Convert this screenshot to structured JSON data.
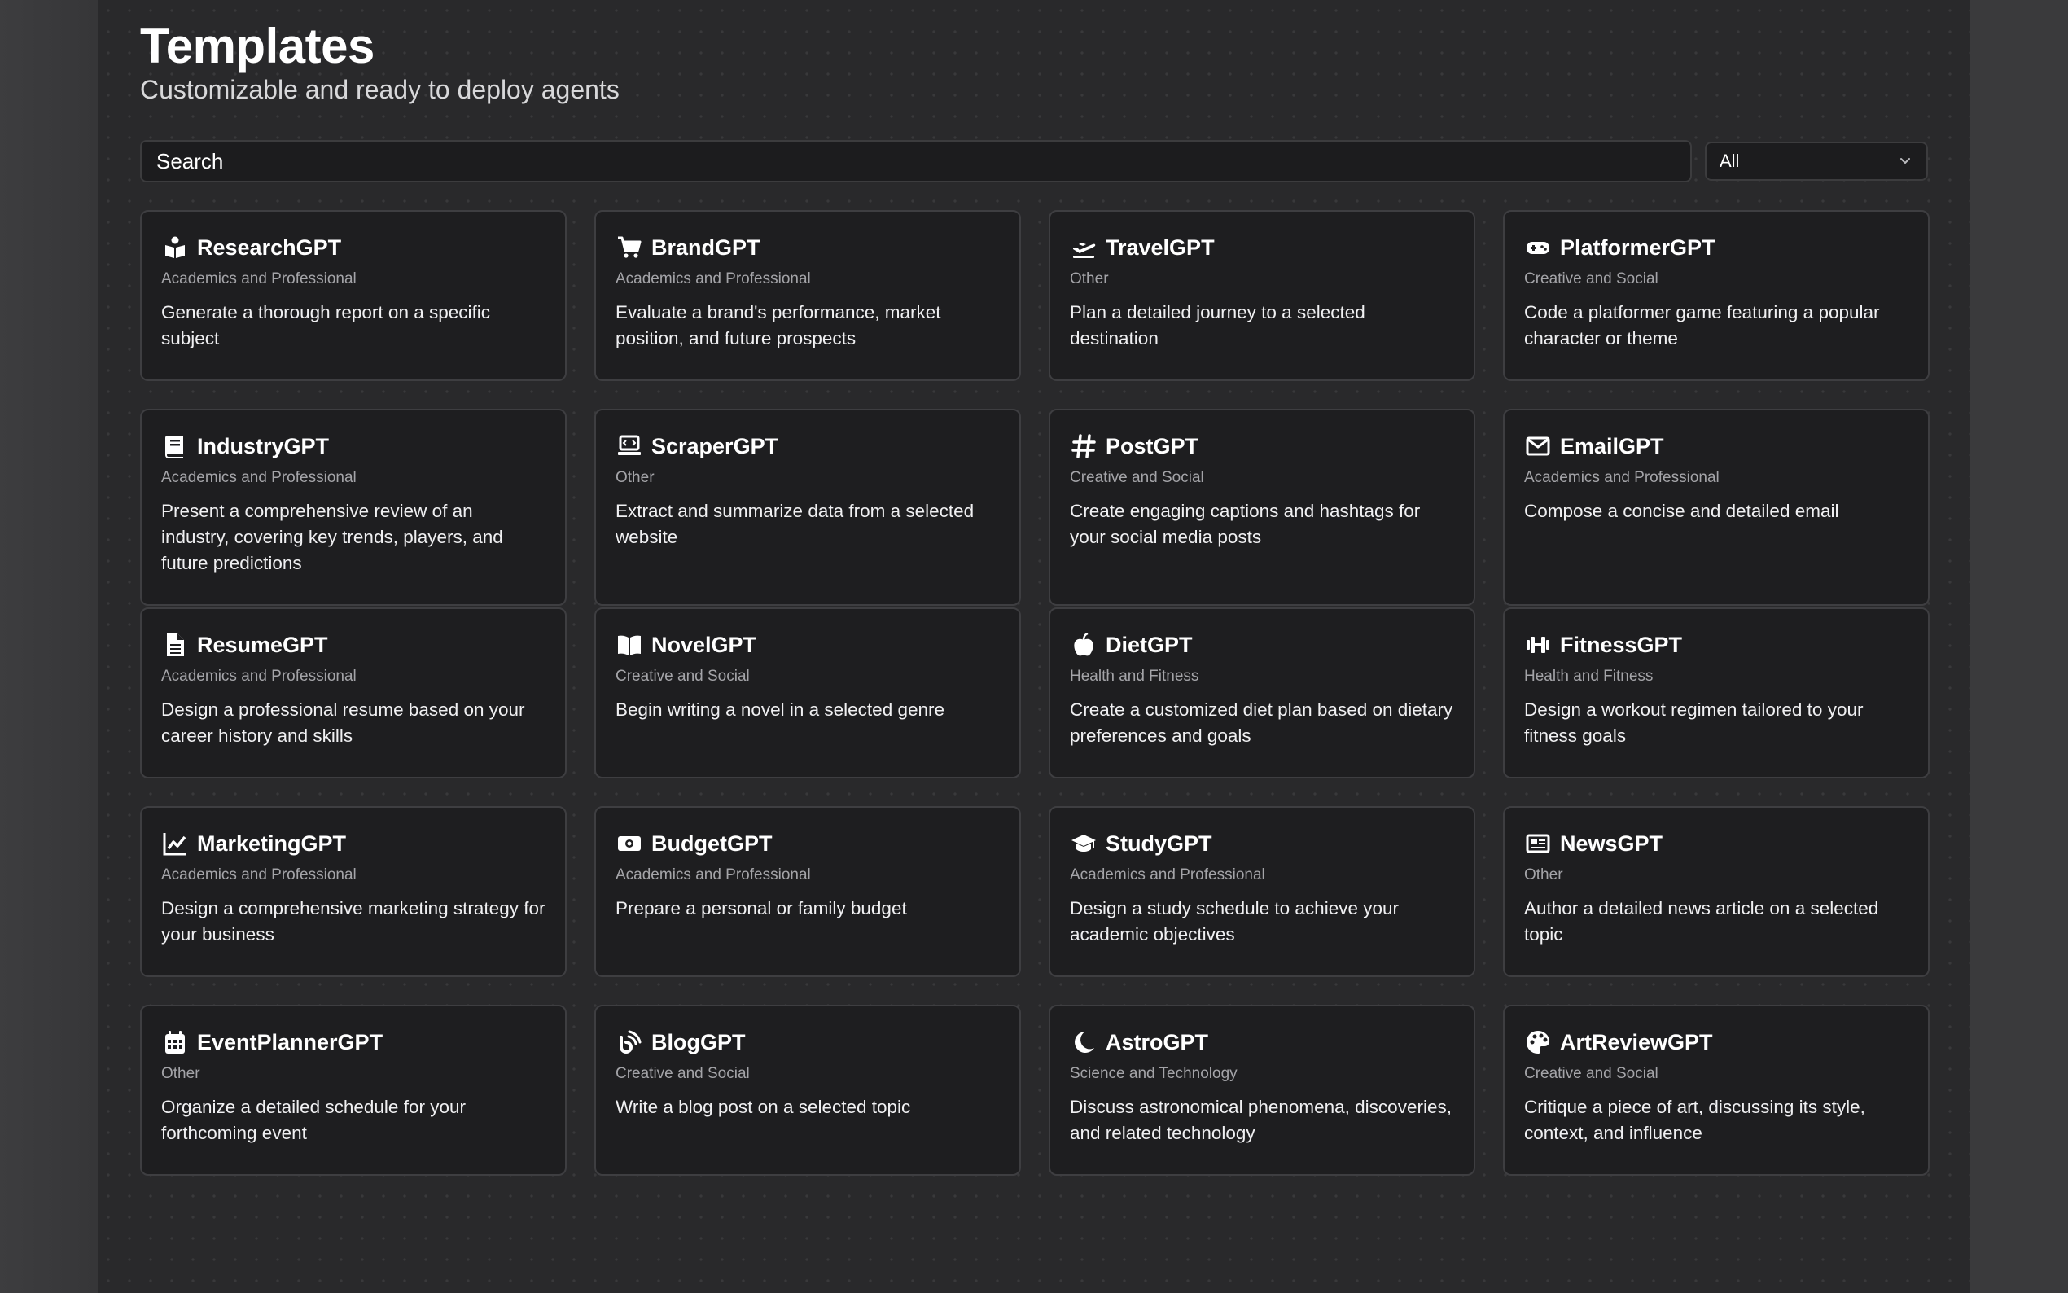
{
  "header": {
    "title": "Templates",
    "subtitle": "Customizable and ready to deploy agents"
  },
  "search": {
    "placeholder": "Search"
  },
  "filter": {
    "selected": "All"
  },
  "templates": [
    {
      "name": "ResearchGPT",
      "category": "Academics and Professional",
      "description": "Generate a thorough report on a specific subject",
      "icon": "user-book-icon"
    },
    {
      "name": "BrandGPT",
      "category": "Academics and Professional",
      "description": "Evaluate a brand's performance, market position, and future prospects",
      "icon": "cart-icon"
    },
    {
      "name": "TravelGPT",
      "category": "Other",
      "description": "Plan a detailed journey to a selected destination",
      "icon": "plane-departure-icon"
    },
    {
      "name": "PlatformerGPT",
      "category": "Creative and Social",
      "description": "Code a platformer game featuring a popular character or theme",
      "icon": "gamepad-icon"
    },
    {
      "name": "IndustryGPT",
      "category": "Academics and Professional",
      "description": "Present a comprehensive review of an industry, covering key trends, players, and future predictions",
      "icon": "book-icon"
    },
    {
      "name": "ScraperGPT",
      "category": "Other",
      "description": "Extract and summarize data from a selected website",
      "icon": "laptop-code-icon"
    },
    {
      "name": "PostGPT",
      "category": "Creative and Social",
      "description": "Create engaging captions and hashtags for your social media posts",
      "icon": "hashtag-icon"
    },
    {
      "name": "EmailGPT",
      "category": "Academics and Professional",
      "description": "Compose a concise and detailed email",
      "icon": "envelope-icon"
    },
    {
      "name": "ResumeGPT",
      "category": "Academics and Professional",
      "description": "Design a professional resume based on your career history and skills",
      "icon": "file-icon"
    },
    {
      "name": "NovelGPT",
      "category": "Creative and Social",
      "description": "Begin writing a novel in a selected genre",
      "icon": "open-book-icon"
    },
    {
      "name": "DietGPT",
      "category": "Health and Fitness",
      "description": "Create a customized diet plan based on dietary preferences and goals",
      "icon": "apple-icon"
    },
    {
      "name": "FitnessGPT",
      "category": "Health and Fitness",
      "description": "Design a workout regimen tailored to your fitness goals",
      "icon": "dumbbell-icon"
    },
    {
      "name": "MarketingGPT",
      "category": "Academics and Professional",
      "description": "Design a comprehensive marketing strategy for your business",
      "icon": "chart-line-icon"
    },
    {
      "name": "BudgetGPT",
      "category": "Academics and Professional",
      "description": "Prepare a personal or family budget",
      "icon": "money-bill-icon"
    },
    {
      "name": "StudyGPT",
      "category": "Academics and Professional",
      "description": "Design a study schedule to achieve your academic objectives",
      "icon": "graduation-cap-icon"
    },
    {
      "name": "NewsGPT",
      "category": "Other",
      "description": "Author a detailed news article on a selected topic",
      "icon": "newspaper-icon"
    },
    {
      "name": "EventPlannerGPT",
      "category": "Other",
      "description": "Organize a detailed schedule for your forthcoming event",
      "icon": "calendar-icon"
    },
    {
      "name": "BlogGPT",
      "category": "Creative and Social",
      "description": "Write a blog post on a selected topic",
      "icon": "blog-icon"
    },
    {
      "name": "AstroGPT",
      "category": "Science and Technology",
      "description": "Discuss astronomical phenomena, discoveries, and related technology",
      "icon": "moon-star-icon"
    },
    {
      "name": "ArtReviewGPT",
      "category": "Creative and Social",
      "description": "Critique a piece of art, discussing its style, context, and influence",
      "icon": "palette-icon"
    }
  ]
}
